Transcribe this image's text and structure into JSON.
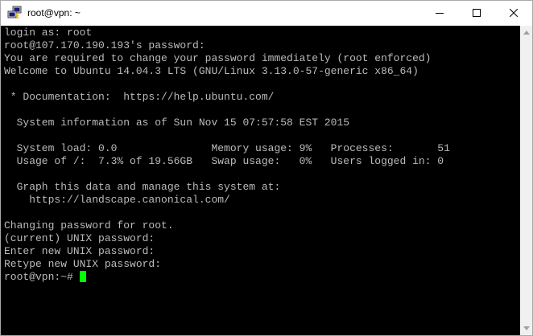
{
  "window": {
    "title": "root@vpn: ~",
    "app_icon": "putty-icon",
    "controls": {
      "minimize_icon": "minimize-icon",
      "maximize_icon": "maximize-icon",
      "close_icon": "close-icon"
    }
  },
  "terminal": {
    "lines": [
      "login as: root",
      "root@107.170.190.193's password:",
      "You are required to change your password immediately (root enforced)",
      "Welcome to Ubuntu 14.04.3 LTS (GNU/Linux 3.13.0-57-generic x86_64)",
      "",
      " * Documentation:  https://help.ubuntu.com/",
      "",
      "  System information as of Sun Nov 15 07:57:58 EST 2015",
      "",
      "  System load: 0.0               Memory usage: 9%   Processes:       51",
      "  Usage of /:  7.3% of 19.56GB   Swap usage:   0%   Users logged in: 0",
      "",
      "  Graph this data and manage this system at:",
      "    https://landscape.canonical.com/",
      "",
      "Changing password for root.",
      "(current) UNIX password:",
      "Enter new UNIX password:",
      "Retype new UNIX password:"
    ],
    "prompt": "root@vpn:~# ",
    "colors": {
      "background": "#000000",
      "foreground": "#bbbbbb",
      "cursor": "#00ff00"
    }
  },
  "scrollbar": {
    "up_icon": "scroll-up-arrow-icon",
    "down_icon": "scroll-down-arrow-icon"
  }
}
